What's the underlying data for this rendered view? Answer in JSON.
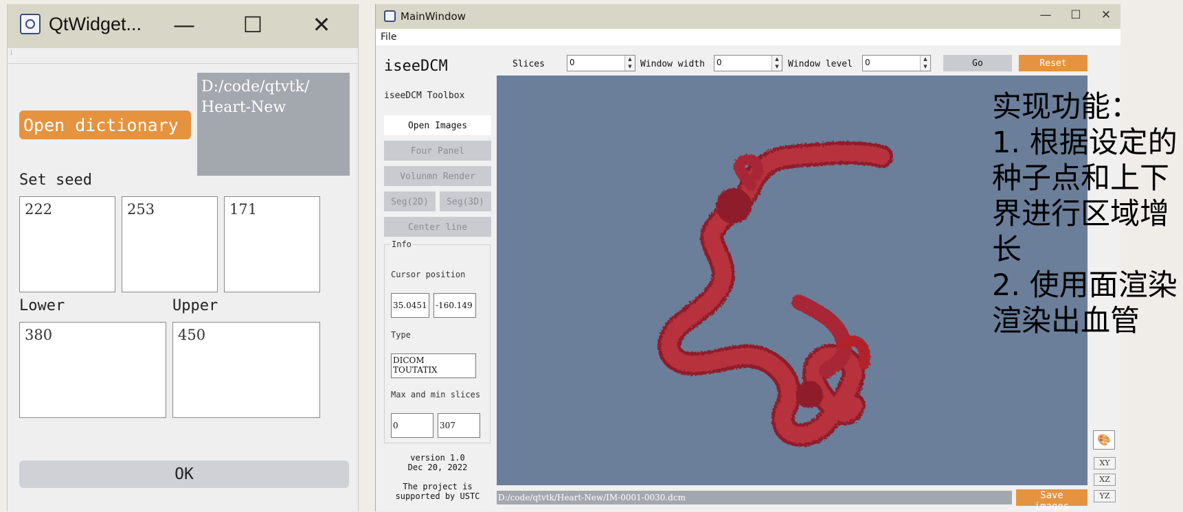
{
  "dialog": {
    "title": "QtWidget...",
    "controls": {
      "minimize": "—",
      "maximize": "☐",
      "close": "✕"
    },
    "open_button": "Open dictionary",
    "path_text": "D:/code/qtvtk/\nHeart-New",
    "seed_label": "Set seed",
    "seeds": [
      "222",
      "253",
      "171"
    ],
    "lower_label": "Lower",
    "upper_label": "Upper",
    "lower_value": "380",
    "upper_value": "450",
    "ok_button": "OK"
  },
  "main": {
    "title": "MainWindow",
    "controls": {
      "minimize": "—",
      "maximize": "☐",
      "close": "✕"
    },
    "menu_file": "File",
    "app_name": "iseeDCM",
    "toolbox_label": "iseeDCM Toolbox",
    "buttons": {
      "open_images": "Open Images",
      "four_panel": "Four Panel",
      "volume_render": "Volunmn Render",
      "seg2d": "Seg(2D)",
      "seg3d": "Seg(3D)",
      "center_line": "Center line"
    },
    "info": {
      "group_title": "Info",
      "cursor_label": "Cursor position",
      "cursor_x": "35.0451",
      "cursor_y": "-160.149",
      "type_label": "Type",
      "type_value": "DICOM\nTOUTATIX",
      "slices_label": "Max and min slices",
      "slice_min": "0",
      "slice_max": "307"
    },
    "version": "version 1.0\nDec 20, 2022",
    "support": "The project is\nsupported by USTC",
    "top": {
      "slices_label": "Slices",
      "slices_value": "0",
      "ww_label": "Window width",
      "ww_value": "0",
      "wl_label": "Window level",
      "wl_value": "0",
      "go": "Go",
      "reset": "Reset"
    },
    "planes": [
      "XY",
      "XZ",
      "YZ"
    ],
    "status_path": "D:/code/qtvtk/Heart-New/IM-0001-0030.dcm",
    "save_button": "Save images",
    "colors": {
      "accent": "#e5933f",
      "viewport_bg": "#6b7f9a",
      "vessel": "#b3212c"
    }
  },
  "annotation": {
    "heading": "实现功能：",
    "items": [
      "1. 根据设定的种子点和上下界进行区域增长",
      "2. 使用面渲染渲染出血管"
    ]
  }
}
